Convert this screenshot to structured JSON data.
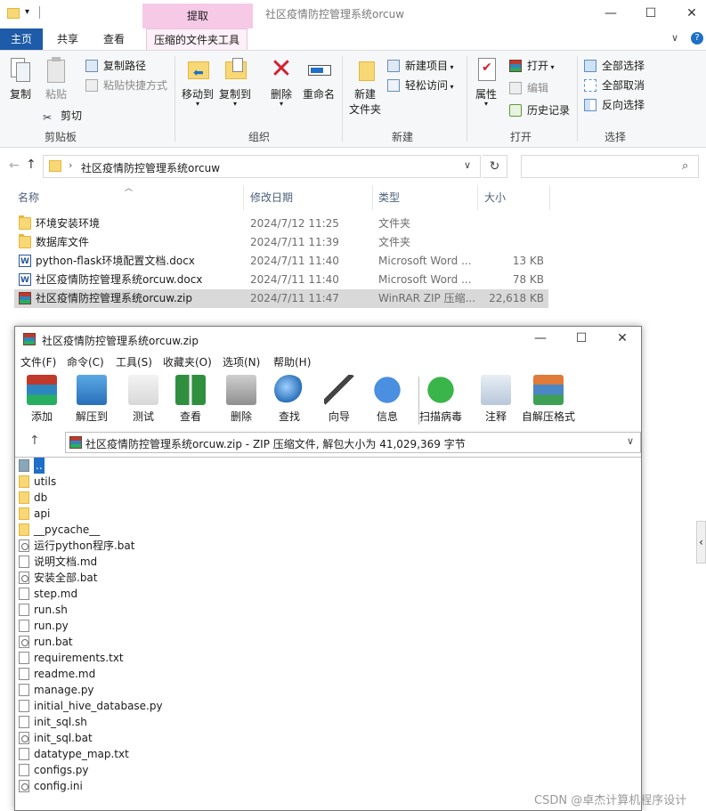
{
  "explorer": {
    "title": "社区疫情防控管理系统orcuw",
    "context_tab": "提取",
    "tabs": [
      "主页",
      "共享",
      "查看",
      "压缩的文件夹工具"
    ],
    "ribbon": {
      "clipboard": {
        "label": "剪贴板",
        "copy": "复制",
        "paste": "粘贴",
        "copy_path": "复制路径",
        "paste_shortcut": "粘贴快捷方式",
        "cut": "剪切"
      },
      "organize": {
        "label": "组织",
        "move_to": "移动到",
        "copy_to": "复制到",
        "delete": "删除",
        "rename": "重命名"
      },
      "new": {
        "label": "新建",
        "new_folder_line1": "新建",
        "new_folder_line2": "文件夹",
        "new_item": "新建项目",
        "easy_access": "轻松访问"
      },
      "open": {
        "label": "打开",
        "properties": "属性",
        "open": "打开",
        "edit": "编辑",
        "history": "历史记录"
      },
      "select": {
        "label": "选择",
        "select_all": "全部选择",
        "select_none": "全部取消",
        "invert": "反向选择"
      }
    },
    "address": "社区疫情防控管理系统orcuw",
    "columns": {
      "name": "名称",
      "date": "修改日期",
      "type": "类型",
      "size": "大小"
    },
    "files": [
      {
        "name": "环境安装环境",
        "date": "2024/7/12 11:25",
        "type": "文件夹",
        "size": "",
        "icon": "folder"
      },
      {
        "name": "数据库文件",
        "date": "2024/7/11 11:39",
        "type": "文件夹",
        "size": "",
        "icon": "folder"
      },
      {
        "name": "python-flask环境配置文档.docx",
        "date": "2024/7/11 11:40",
        "type": "Microsoft Word ...",
        "size": "13 KB",
        "icon": "word"
      },
      {
        "name": "社区疫情防控管理系统orcuw.docx",
        "date": "2024/7/11 11:40",
        "type": "Microsoft Word ...",
        "size": "78 KB",
        "icon": "word"
      },
      {
        "name": "社区疫情防控管理系统orcuw.zip",
        "date": "2024/7/11 11:47",
        "type": "WinRAR ZIP 压缩...",
        "size": "22,618 KB",
        "icon": "rar"
      }
    ]
  },
  "winrar": {
    "title": "社区疫情防控管理系统orcuw.zip",
    "menu": [
      "文件(F)",
      "命令(C)",
      "工具(S)",
      "收藏夹(O)",
      "选项(N)",
      "帮助(H)"
    ],
    "toolbar": [
      "添加",
      "解压到",
      "测试",
      "查看",
      "删除",
      "查找",
      "向导",
      "信息",
      "扫描病毒",
      "注释",
      "自解压格式"
    ],
    "path": "社区疫情防控管理系统orcuw.zip - ZIP 压缩文件, 解包大小为 41,029,369 字节",
    "entries": [
      {
        "name": "..",
        "icon": "up"
      },
      {
        "name": "utils",
        "icon": "folder"
      },
      {
        "name": "db",
        "icon": "folder"
      },
      {
        "name": "api",
        "icon": "folder"
      },
      {
        "name": "__pycache__",
        "icon": "folder"
      },
      {
        "name": "运行python程序.bat",
        "icon": "bat"
      },
      {
        "name": "说明文档.md",
        "icon": "file"
      },
      {
        "name": "安装全部.bat",
        "icon": "bat"
      },
      {
        "name": "step.md",
        "icon": "file"
      },
      {
        "name": "run.sh",
        "icon": "file"
      },
      {
        "name": "run.py",
        "icon": "file"
      },
      {
        "name": "run.bat",
        "icon": "bat"
      },
      {
        "name": "requirements.txt",
        "icon": "file"
      },
      {
        "name": "readme.md",
        "icon": "file"
      },
      {
        "name": "manage.py",
        "icon": "file"
      },
      {
        "name": "initial_hive_database.py",
        "icon": "file"
      },
      {
        "name": "init_sql.sh",
        "icon": "file"
      },
      {
        "name": "init_sql.bat",
        "icon": "bat"
      },
      {
        "name": "datatype_map.txt",
        "icon": "file"
      },
      {
        "name": "configs.py",
        "icon": "file"
      },
      {
        "name": "config.ini",
        "icon": "bat"
      }
    ]
  },
  "watermark": "CSDN @卓杰计算机程序设计"
}
